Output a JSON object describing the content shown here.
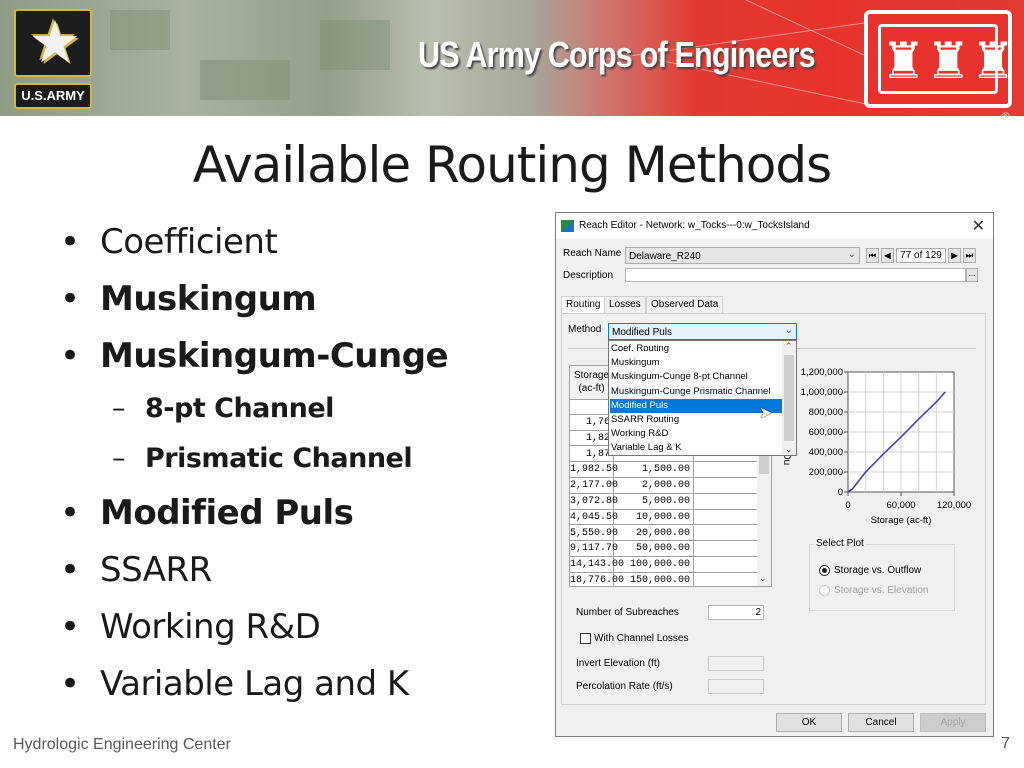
{
  "banner": {
    "army_logo_label": "U.S.ARMY",
    "org_title": "US Army Corps of Engineers",
    "registered_mark": "®",
    "colors": {
      "army_gold": "#d7b544",
      "corps_red": "#e8322d"
    }
  },
  "slide": {
    "title": "Available Routing Methods",
    "bullets": [
      {
        "text": "Coefficient",
        "bold": false
      },
      {
        "text": "Muskingum",
        "bold": true
      },
      {
        "text": "Muskingum-Cunge",
        "bold": true
      },
      {
        "text": "8-pt Channel",
        "bold": true,
        "sub": true
      },
      {
        "text": "Prismatic Channel",
        "bold": true,
        "sub": true
      },
      {
        "text": "Modified Puls",
        "bold": true
      },
      {
        "text": "SSARR",
        "bold": false
      },
      {
        "text": "Working R&D",
        "bold": false
      },
      {
        "text": "Variable Lag and K",
        "bold": false
      }
    ],
    "bullet_glyph": "•",
    "sub_glyph": "–",
    "footer_left": "Hydrologic Engineering Center",
    "page_number": "7"
  },
  "dialog": {
    "title": "Reach Editor - Network: w_Tocks---0:w_TocksIsland",
    "close_glyph": "✕",
    "reach_name_label": "Reach Name",
    "reach_name_value": "Delaware_R240",
    "description_label": "Description",
    "description_value": "",
    "browse_glyph": "...",
    "record_count": "77 of 129",
    "nav": {
      "first": "⏮",
      "prev": "◀",
      "next": "▶",
      "last": "⏭"
    },
    "tabs": [
      {
        "label": "Routing",
        "active": true
      },
      {
        "label": "Losses",
        "active": false
      },
      {
        "label": "Observed Data",
        "active": false
      }
    ],
    "method_label": "Method",
    "method_value": "Modified Puls",
    "method_options": [
      "Coef. Routing",
      "Muskingum",
      "Muskingum-Cunge 8-pt Channel",
      "Muskingum-Cunge Prismatic Channel",
      "Modified Puls",
      "SSARR Routing",
      "Working R&D",
      "Variable Lag & K"
    ],
    "selected_option_index": 4,
    "table": {
      "header_col1_line1": "Storage",
      "header_col1_line2": "(ac-ft)",
      "rows": [
        [
          "1,76",
          ""
        ],
        [
          "1,82",
          ""
        ],
        [
          "1,87",
          ""
        ],
        [
          "1,982.50",
          "1,500.00"
        ],
        [
          "2,177.00",
          "2,000.00"
        ],
        [
          "3,072.80",
          "5,000.00"
        ],
        [
          "4,045.50",
          "10,000.00"
        ],
        [
          "5,550.90",
          "20,000.00"
        ],
        [
          "9,117.70",
          "50,000.00"
        ],
        [
          "14,143.00",
          "100,000.00"
        ],
        [
          "18,776.00",
          "150,000.00"
        ]
      ]
    },
    "plot": {
      "y_ticks": [
        "1,200,000",
        "1,000,000",
        "800,000",
        "600,000",
        "400,000",
        "200,000",
        "0"
      ],
      "x_ticks": [
        "0",
        "60,000",
        "120,000"
      ],
      "xlabel": "Storage (ac-ft)",
      "ylabel_partial": "Ou",
      "line_color": "#3333cc"
    },
    "select_plot": {
      "legend": "Select Plot",
      "options": [
        {
          "label": "Storage vs. Outflow",
          "checked": true,
          "enabled": true
        },
        {
          "label": "Storage vs. Elevation",
          "checked": false,
          "enabled": false
        }
      ]
    },
    "subreaches_label": "Number of Subreaches",
    "subreaches_value": "2",
    "channel_losses_label": "With Channel Losses",
    "channel_losses_checked": false,
    "invert_elevation_label": "Invert Elevation (ft)",
    "invert_elevation_value": "",
    "percolation_label": "Percolation Rate (ft/s)",
    "percolation_value": "",
    "buttons": {
      "ok": "OK",
      "cancel": "Cancel",
      "apply": "Apply"
    }
  },
  "chart_data": {
    "type": "line",
    "title": "",
    "xlabel": "Storage (ac-ft)",
    "ylabel": "Outflow",
    "xlim": [
      0,
      120000
    ],
    "ylim": [
      0,
      1200000
    ],
    "x_ticks": [
      0,
      60000,
      120000
    ],
    "y_ticks": [
      0,
      200000,
      400000,
      600000,
      800000,
      1000000,
      1200000
    ],
    "grid": true,
    "series": [
      {
        "name": "Storage vs. Outflow",
        "x": [
          0,
          5000,
          20000,
          40000,
          60000,
          80000,
          100000,
          110000
        ],
        "y": [
          0,
          30000,
          200000,
          380000,
          550000,
          730000,
          900000,
          1000000
        ]
      }
    ]
  }
}
